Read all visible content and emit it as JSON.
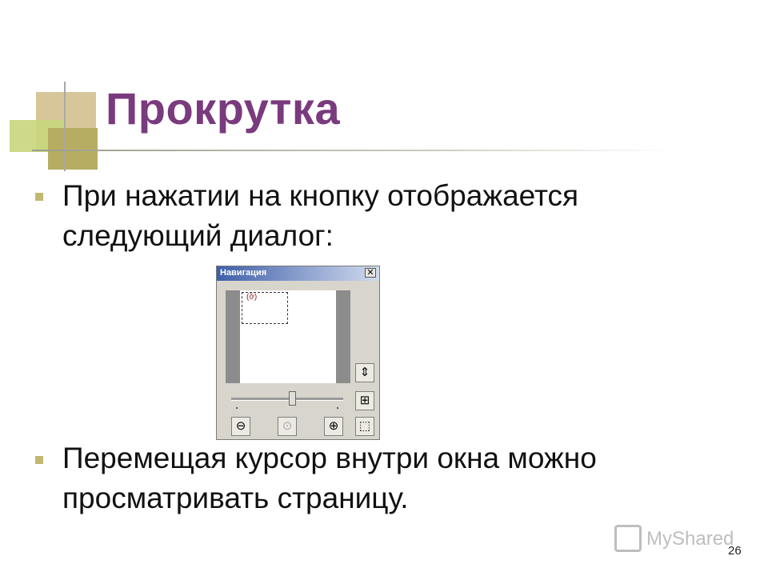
{
  "slide": {
    "title": "Прокрутка",
    "bullet1": "При нажатии на кнопку отображается следующий диалог:",
    "bullet2": "Перемещая курсор внутри окна можно просматривать страницу.",
    "page_number": "26"
  },
  "dialog": {
    "title": "Навигация",
    "close_glyph": "✕",
    "icons": [
      "scroll-arrows-icon",
      "fit-view-icon",
      "zoom-out-icon",
      "zoom-reset-icon",
      "zoom-in-icon",
      "zoom-select-icon"
    ],
    "zoom_slider_level": 0.56
  },
  "watermark": {
    "text": "MyShared"
  },
  "colors": {
    "title": "#7a3a7e",
    "bullet": "#c2b872",
    "dialog_title": "#3e5fa8"
  }
}
